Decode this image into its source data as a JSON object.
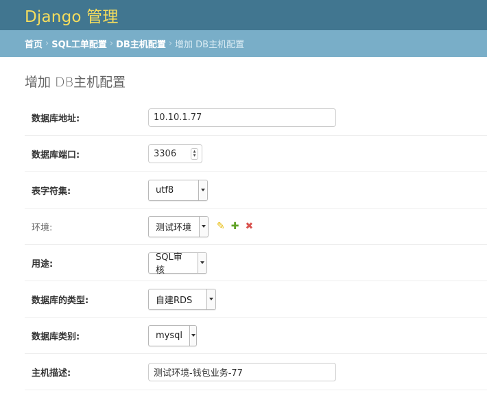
{
  "header": {
    "branding": "Django 管理"
  },
  "breadcrumbs": {
    "items": [
      "首页",
      "SQL工单配置",
      "DB主机配置"
    ],
    "current": "增加 DB主机配置",
    "separator": "›"
  },
  "page_title": "增加 DB主机配置",
  "form": {
    "db_address": {
      "label": "数据库地址:",
      "value": "10.10.1.77"
    },
    "db_port": {
      "label": "数据库端口:",
      "value": "3306"
    },
    "charset": {
      "label": "表字符集:",
      "value": "utf8"
    },
    "environment": {
      "label": "环境:",
      "value": "测试环境"
    },
    "usage": {
      "label": "用途:",
      "value": "SQL审核"
    },
    "db_type": {
      "label": "数据库的类型:",
      "value": "自建RDS"
    },
    "db_category": {
      "label": "数据库类别:",
      "value": "mysql"
    },
    "host_desc": {
      "label": "主机描述:",
      "value": "测试环境-钱包业务-77"
    }
  },
  "icons": {
    "edit": "pencil-icon",
    "add": "plus-icon",
    "delete": "x-icon"
  },
  "colors": {
    "header_bg": "#417690",
    "branding": "#f5dd5d",
    "breadcrumbs_bg": "#79aec8"
  }
}
